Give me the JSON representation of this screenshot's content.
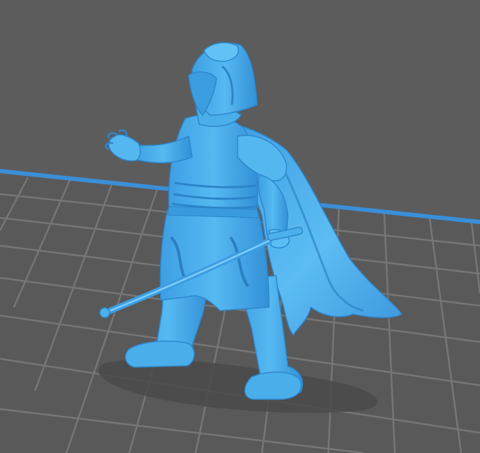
{
  "viewport": {
    "background_color": "#5c5c5c",
    "bed_color": "#595959",
    "grid_line_color": "#767676",
    "bed_edge_color": "#3a8fd8",
    "shadow_color": "#4a4a4a"
  },
  "model": {
    "color": "#4fb3ef",
    "shade_color": "#2f8fd2",
    "highlight_color": "#8fd4ff",
    "selected": true
  }
}
